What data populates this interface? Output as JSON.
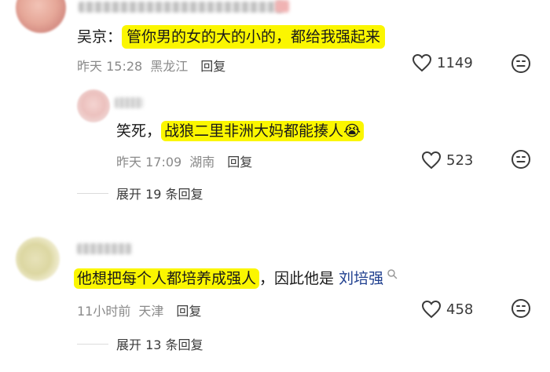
{
  "comments": [
    {
      "author_name": "吴京",
      "text": "管你男的女的大的小的，都给我强起来",
      "time": "昨天 15:28",
      "location": "黑龙江",
      "reply_label": "回复",
      "likes": "1149"
    },
    {
      "text_prefix": "笑死，",
      "text": "战狼二里非洲大妈都能揍人",
      "emoji": "😭",
      "time": "昨天 17:09",
      "location": "湖南",
      "reply_label": "回复",
      "likes": "523",
      "expand_label": "展开 19 条回复"
    },
    {
      "text_main": "他想把每个人都培养成强人",
      "text_suffix": "，因此他是",
      "link_text": "刘培强",
      "time": "11小时前",
      "location": "天津",
      "reply_label": "回复",
      "likes": "458",
      "expand_label": "展开 13 条回复"
    }
  ],
  "icons": {
    "like": "heart-icon",
    "dislike": "emoji-face-icon",
    "search": "search-icon"
  },
  "colors": {
    "highlight": "#fbf600",
    "link": "#1f3f8f",
    "meta": "#8a8a8a"
  }
}
